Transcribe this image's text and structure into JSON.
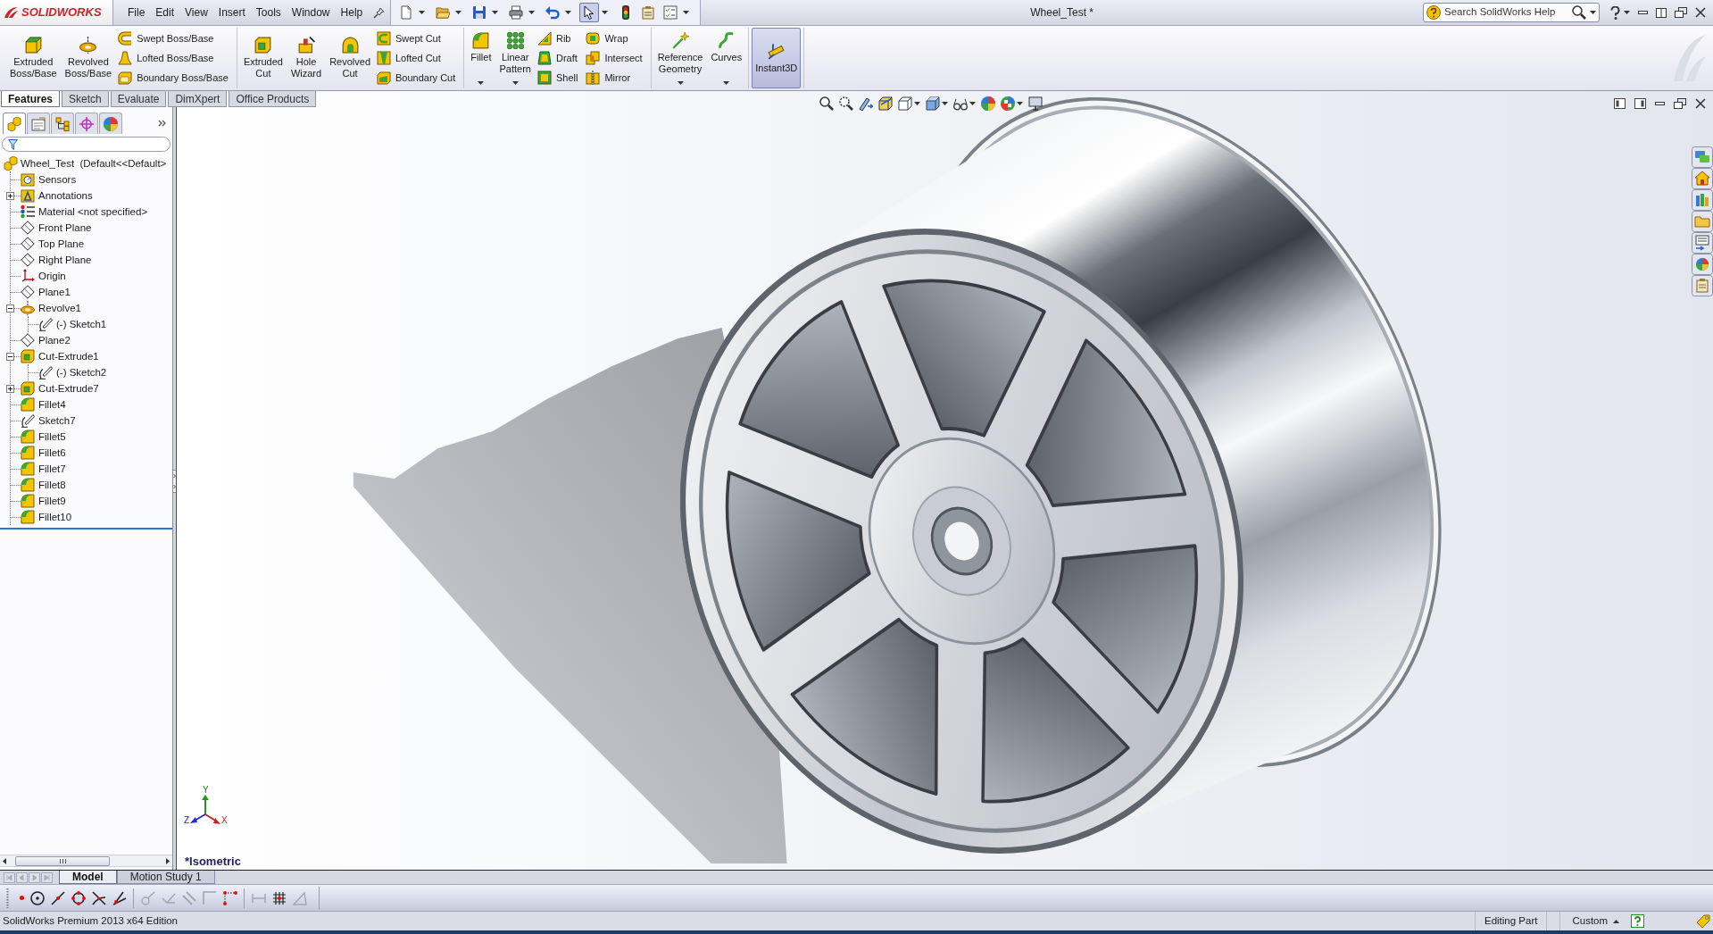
{
  "app": {
    "logo": "SOLIDWORKS"
  },
  "menu": [
    "File",
    "Edit",
    "View",
    "Insert",
    "Tools",
    "Window",
    "Help"
  ],
  "quick_access": [
    {
      "on": false,
      "dropdown": true
    },
    {
      "on": false,
      "dropdown": true
    },
    {
      "on": false,
      "dropdown": true
    },
    {
      "on": false,
      "dropdown": true
    },
    {
      "on": false,
      "dropdown": true
    },
    {
      "on": true,
      "dropdown": true
    },
    {
      "on": false
    },
    {
      "on": false
    },
    {
      "on": false,
      "dropdown": true
    }
  ],
  "window": {
    "title": "Wheel_Test *"
  },
  "search": {
    "placeholder": "Search SolidWorks Help"
  },
  "ribbon": {
    "groups": [
      {
        "items": [
          {
            "kind": "large",
            "label": "Extruded Boss/Base"
          },
          {
            "kind": "large",
            "label": "Revolved Boss/Base"
          },
          {
            "kind": "stack",
            "items": [
              {
                "label": "Swept Boss/Base"
              },
              {
                "label": "Lofted Boss/Base"
              },
              {
                "label": "Boundary Boss/Base"
              }
            ]
          }
        ]
      },
      {
        "items": [
          {
            "kind": "large",
            "label": "Extruded Cut"
          },
          {
            "kind": "large",
            "label": "Hole Wizard"
          },
          {
            "kind": "large",
            "label": "Revolved Cut"
          },
          {
            "kind": "stack",
            "items": [
              {
                "label": "Swept Cut"
              },
              {
                "label": "Lofted Cut"
              },
              {
                "label": "Boundary Cut"
              }
            ]
          }
        ]
      },
      {
        "items": [
          {
            "kind": "large",
            "label": "Fillet",
            "dropdown": true
          },
          {
            "kind": "large",
            "label": "Linear Pattern",
            "dropdown": true
          },
          {
            "kind": "stack",
            "items": [
              {
                "label": "Rib"
              },
              {
                "label": "Draft"
              },
              {
                "label": "Shell"
              }
            ]
          },
          {
            "kind": "stack",
            "items": [
              {
                "label": "Wrap"
              },
              {
                "label": "Intersect"
              },
              {
                "label": "Mirror"
              }
            ]
          }
        ]
      },
      {
        "items": [
          {
            "kind": "large",
            "label": "Reference Geometry",
            "dropdown": true
          },
          {
            "kind": "large",
            "label": "Curves",
            "dropdown": true
          }
        ]
      },
      {
        "items": [
          {
            "kind": "large",
            "label": "Instant3D",
            "on": true
          }
        ]
      }
    ]
  },
  "command_tabs": [
    {
      "label": "Features",
      "selected": true
    },
    {
      "label": "Sketch",
      "selected": false
    },
    {
      "label": "Evaluate",
      "selected": false
    },
    {
      "label": "DimXpert",
      "selected": false
    },
    {
      "label": "Office Products",
      "selected": false
    }
  ],
  "feature_manager": {
    "panel_tabs": [
      {
        "selected": true
      },
      {
        "selected": false
      },
      {
        "selected": false
      },
      {
        "selected": false
      },
      {
        "selected": false
      }
    ],
    "tree": {
      "label": "Wheel_Test  (Default<<Default>",
      "kind": "part",
      "children": [
        {
          "label": "Sensors",
          "kind": "sensors"
        },
        {
          "label": "Annotations",
          "kind": "annotations",
          "expanded": false
        },
        {
          "label": "Material <not specified>",
          "kind": "material"
        },
        {
          "label": "Front Plane",
          "kind": "plane"
        },
        {
          "label": "Top Plane",
          "kind": "plane"
        },
        {
          "label": "Right Plane",
          "kind": "plane"
        },
        {
          "label": "Origin",
          "kind": "origin"
        },
        {
          "label": "Plane1",
          "kind": "plane"
        },
        {
          "label": "Revolve1",
          "kind": "revolve",
          "expanded": true,
          "children": [
            {
              "label": "(-) Sketch1",
              "kind": "sketch"
            }
          ]
        },
        {
          "label": "Plane2",
          "kind": "plane"
        },
        {
          "label": "Cut-Extrude1",
          "kind": "cut",
          "expanded": true,
          "children": [
            {
              "label": "(-) Sketch2",
              "kind": "sketch"
            }
          ]
        },
        {
          "label": "Cut-Extrude7",
          "kind": "cut",
          "expanded": false
        },
        {
          "label": "Fillet4",
          "kind": "fillet"
        },
        {
          "label": "Sketch7",
          "kind": "sketch"
        },
        {
          "label": "Fillet5",
          "kind": "fillet"
        },
        {
          "label": "Fillet6",
          "kind": "fillet"
        },
        {
          "label": "Fillet7",
          "kind": "fillet"
        },
        {
          "label": "Fillet8",
          "kind": "fillet"
        },
        {
          "label": "Fillet9",
          "kind": "fillet"
        },
        {
          "label": "Fillet10",
          "kind": "fillet"
        }
      ]
    }
  },
  "graphics": {
    "view_name": "*Isometric",
    "triad_labels": [
      "Y",
      "Z",
      "X"
    ]
  },
  "bottom_tabs": [
    {
      "label": "Model",
      "selected": true
    },
    {
      "label": "Motion Study 1",
      "selected": false
    }
  ],
  "sketch_tools": [
    {
      "disabled": false
    },
    {
      "disabled": false
    },
    {
      "disabled": false
    },
    {
      "disabled": false
    },
    {
      "disabled": false
    },
    {
      "disabled": false
    },
    {
      "disabled": true
    },
    {
      "disabled": true
    },
    {
      "disabled": true
    },
    {
      "disabled": true
    },
    {
      "disabled": false
    },
    {
      "disabled": true
    },
    {
      "disabled": false
    },
    {
      "disabled": true
    }
  ],
  "status_bar": {
    "edition": "SolidWorks Premium 2013 x64 Edition",
    "mode": "Editing Part",
    "units": "Custom"
  }
}
